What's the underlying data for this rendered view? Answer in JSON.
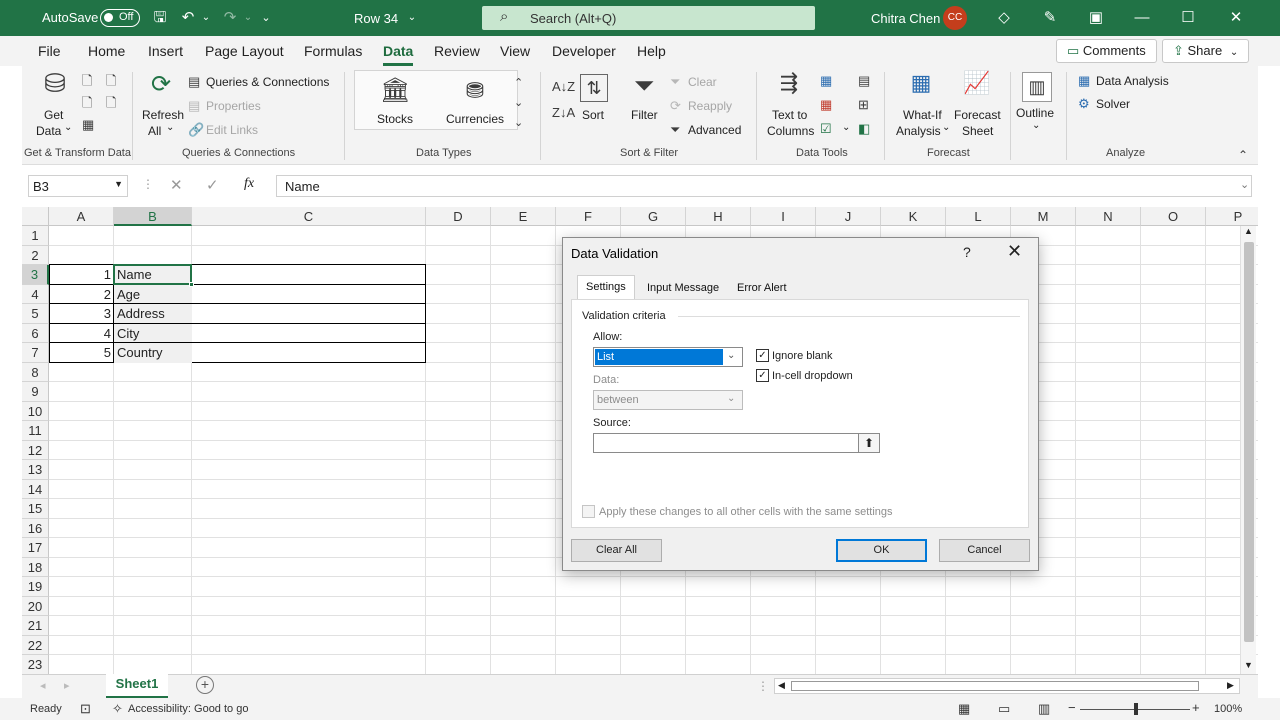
{
  "titlebar": {
    "autosave_label": "AutoSave",
    "autosave_state": "Off",
    "doc_title": "Row 34",
    "doc_title_caret": "⌄",
    "search_placeholder": "Search (Alt+Q)",
    "user_name": "Chitra Chen",
    "user_initials": "CC",
    "accent_color": "#217346",
    "avatar_color": "#c43e1c"
  },
  "menu": {
    "tabs": [
      "File",
      "Home",
      "Insert",
      "Page Layout",
      "Formulas",
      "Data",
      "Review",
      "View",
      "Developer",
      "Help"
    ],
    "active_tab": "Data",
    "comments_label": "Comments",
    "share_label": "Share",
    "share_caret": "⌄"
  },
  "ribbon": {
    "get_data_line1": "Get",
    "get_data_line2": "Data",
    "refresh_line1": "Refresh",
    "refresh_line2": "All",
    "caret": "⌄",
    "queries_connections": "Queries & Connections",
    "properties": "Properties",
    "edit_links": "Edit Links",
    "stocks": "Stocks",
    "currencies": "Currencies",
    "sort": "Sort",
    "filter": "Filter",
    "clear": "Clear",
    "reapply": "Reapply",
    "advanced": "Advanced",
    "text_to_columns_line1": "Text to",
    "text_to_columns_line2": "Columns",
    "what_if_line1": "What-If",
    "what_if_line2": "Analysis",
    "forecast_sheet_line1": "Forecast",
    "forecast_sheet_line2": "Sheet",
    "outline": "Outline",
    "data_analysis": "Data Analysis",
    "solver": "Solver",
    "groups": {
      "get_transform": "Get & Transform Data",
      "queries": "Queries & Connections",
      "data_types": "Data Types",
      "sort_filter": "Sort & Filter",
      "data_tools": "Data Tools",
      "forecast": "Forecast",
      "analyze": "Analyze"
    }
  },
  "formula_bar": {
    "name_box": "B3",
    "fx_label": "fx",
    "formula": "Name"
  },
  "grid": {
    "columns": [
      "A",
      "B",
      "C",
      "D",
      "E",
      "F",
      "G",
      "H",
      "I",
      "J",
      "K",
      "L",
      "M",
      "N",
      "O",
      "P"
    ],
    "rows": [
      "1",
      "2",
      "3",
      "4",
      "5",
      "6",
      "7",
      "8",
      "9",
      "10",
      "11",
      "12",
      "13",
      "14",
      "15",
      "16",
      "17",
      "18",
      "19",
      "20",
      "21",
      "22",
      "23"
    ],
    "selected_cell": "B3",
    "data_rows": [
      {
        "row": 3,
        "a": "1",
        "b": "Name"
      },
      {
        "row": 4,
        "a": "2",
        "b": "Age"
      },
      {
        "row": 5,
        "a": "3",
        "b": "Address"
      },
      {
        "row": 6,
        "a": "4",
        "b": "City"
      },
      {
        "row": 7,
        "a": "5",
        "b": "Country"
      }
    ]
  },
  "sheets": {
    "active": "Sheet1",
    "add_sheet_icon": "+"
  },
  "status": {
    "ready": "Ready",
    "accessibility": "Accessibility: Good to go",
    "zoom": "100%",
    "zoom_out": "−",
    "zoom_in": "+"
  },
  "dialog": {
    "title": "Data Validation",
    "help": "?",
    "close": "✕",
    "tabs": [
      "Settings",
      "Input Message",
      "Error Alert"
    ],
    "active_tab": "Settings",
    "section": "Validation criteria",
    "allow_label": "Allow:",
    "allow_value": "List",
    "ignore_blank_label": "Ignore blank",
    "ignore_blank_checked": true,
    "in_cell_dropdown_label": "In-cell dropdown",
    "in_cell_dropdown_checked": true,
    "data_label": "Data:",
    "data_value": "between",
    "source_label": "Source:",
    "source_value": "",
    "apply_all_label": "Apply these changes to all other cells with the same settings",
    "clear_all_label": "Clear All",
    "ok_label": "OK",
    "cancel_label": "Cancel"
  }
}
